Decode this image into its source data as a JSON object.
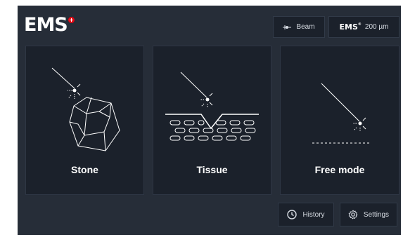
{
  "header": {
    "logo_text": "EMS",
    "beam_label": "Beam",
    "fiber_brand": "EMS",
    "fiber_brand_mark": "®",
    "fiber_size": "200 µm"
  },
  "modes": [
    {
      "label": "Stone",
      "icon": "stone-icon"
    },
    {
      "label": "Tissue",
      "icon": "tissue-icon"
    },
    {
      "label": "Free mode",
      "icon": "free-mode-icon"
    }
  ],
  "footer": {
    "history_label": "History",
    "history_icon": "clock-icon",
    "settings_label": "Settings",
    "settings_icon": "gear-icon"
  },
  "colors": {
    "background": "#262d38",
    "card": "#1b212b",
    "accent_red": "#e30613",
    "line": "#ffffff"
  }
}
